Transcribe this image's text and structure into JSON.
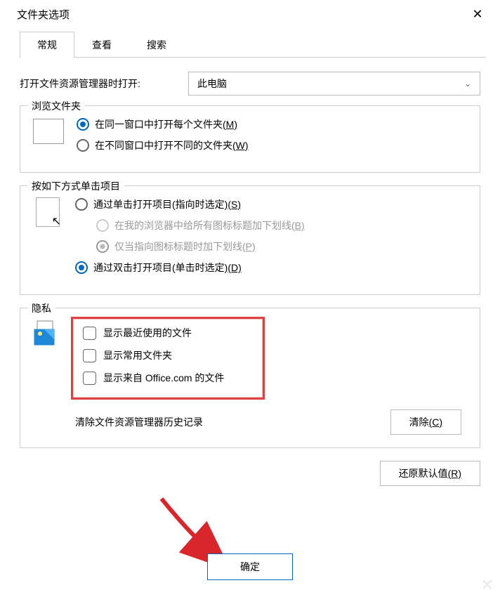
{
  "window": {
    "title": "文件夹选项"
  },
  "tabs": {
    "general": "常规",
    "view": "查看",
    "search": "搜索"
  },
  "openWith": {
    "label": "打开文件资源管理器时打开:",
    "value": "此电脑"
  },
  "browse": {
    "legend": "浏览文件夹",
    "sameWindow": "在同一窗口中打开每个文件夹",
    "sameWindowKey": "(M)",
    "newWindow": "在不同窗口中打开不同的文件夹",
    "newWindowKey": "(W)"
  },
  "click": {
    "legend": "按如下方式单击项目",
    "single": "通过单击打开项目(指向时选定)",
    "singleKey": "(S)",
    "browserUnderline": "在我的浏览器中给所有图标标题加下划线",
    "browserKey": "(B)",
    "pointUnderline": "仅当指向图标标题时加下划线",
    "pointKey": "(P)",
    "double": "通过双击打开项目(单击时选定)",
    "doubleKey": "(D)"
  },
  "privacy": {
    "legend": "隐私",
    "recent": "显示最近使用的文件",
    "frequent": "显示常用文件夹",
    "office": "显示来自 Office.com 的文件",
    "clearLabel": "清除文件资源管理器历史记录",
    "clearBtn": "清除",
    "clearKey": "(C)"
  },
  "restore": {
    "label": "还原默认值",
    "key": "(R)"
  },
  "ok": "确定"
}
